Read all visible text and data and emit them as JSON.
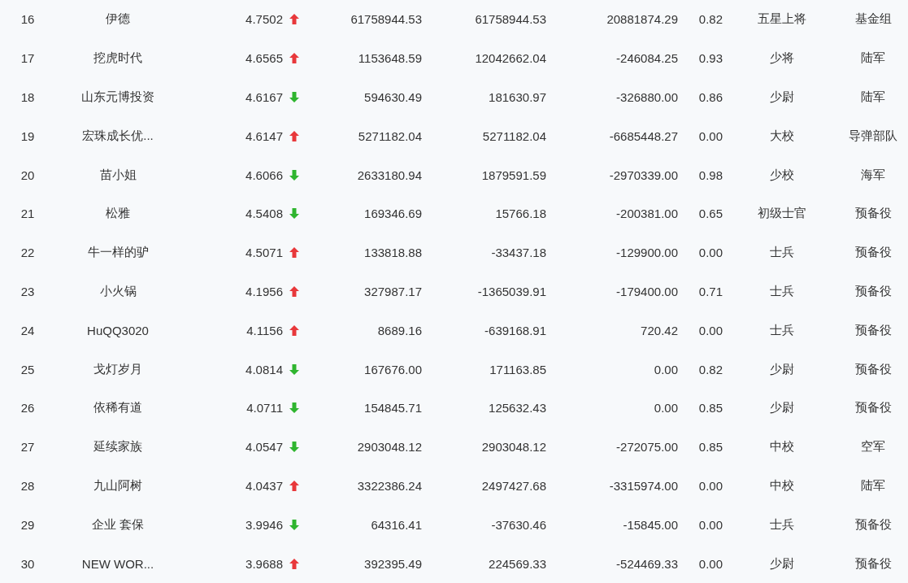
{
  "rows": [
    {
      "rank": "16",
      "name": "伊德",
      "score": "4.7502",
      "rising": true,
      "col_4": "61758944.53",
      "col_5": "61758944.53",
      "col_6": "20881874.29",
      "col_7": "0.82",
      "rank_title": "五星上将",
      "group": "基金组"
    },
    {
      "rank": "17",
      "name": "挖虎时代",
      "score": "4.6565",
      "rising": true,
      "col_4": "1153648.59",
      "col_5": "12042662.04",
      "col_6": "-246084.25",
      "col_7": "0.93",
      "rank_title": "少将",
      "group": "陆军"
    },
    {
      "rank": "18",
      "name": "山东元博投资",
      "score": "4.6167",
      "rising": false,
      "col_4": "594630.49",
      "col_5": "181630.97",
      "col_6": "-326880.00",
      "col_7": "0.86",
      "rank_title": "少尉",
      "group": "陆军"
    },
    {
      "rank": "19",
      "name": "宏珠成长优...",
      "score": "4.6147",
      "rising": true,
      "col_4": "5271182.04",
      "col_5": "5271182.04",
      "col_6": "-6685448.27",
      "col_7": "0.00",
      "rank_title": "大校",
      "group": "导弹部队"
    },
    {
      "rank": "20",
      "name": "苗小姐",
      "score": "4.6066",
      "rising": false,
      "col_4": "2633180.94",
      "col_5": "1879591.59",
      "col_6": "-2970339.00",
      "col_7": "0.98",
      "rank_title": "少校",
      "group": "海军"
    },
    {
      "rank": "21",
      "name": "松雅",
      "score": "4.5408",
      "rising": false,
      "col_4": "169346.69",
      "col_5": "15766.18",
      "col_6": "-200381.00",
      "col_7": "0.65",
      "rank_title": "初级士官",
      "group": "预备役"
    },
    {
      "rank": "22",
      "name": "牛一样的驴",
      "score": "4.5071",
      "rising": true,
      "col_4": "133818.88",
      "col_5": "-33437.18",
      "col_6": "-129900.00",
      "col_7": "0.00",
      "rank_title": "士兵",
      "group": "预备役"
    },
    {
      "rank": "23",
      "name": "小火锅",
      "score": "4.1956",
      "rising": true,
      "col_4": "327987.17",
      "col_5": "-1365039.91",
      "col_6": "-179400.00",
      "col_7": "0.71",
      "rank_title": "士兵",
      "group": "预备役"
    },
    {
      "rank": "24",
      "name": "HuQQ3020",
      "score": "4.1156",
      "rising": true,
      "col_4": "8689.16",
      "col_5": "-639168.91",
      "col_6": "720.42",
      "col_7": "0.00",
      "rank_title": "士兵",
      "group": "预备役"
    },
    {
      "rank": "25",
      "name": "戈灯岁月",
      "score": "4.0814",
      "rising": false,
      "col_4": "167676.00",
      "col_5": "171163.85",
      "col_6": "0.00",
      "col_7": "0.82",
      "rank_title": "少尉",
      "group": "预备役"
    },
    {
      "rank": "26",
      "name": "依稀有道",
      "score": "4.0711",
      "rising": false,
      "col_4": "154845.71",
      "col_5": "125632.43",
      "col_6": "0.00",
      "col_7": "0.85",
      "rank_title": "少尉",
      "group": "预备役"
    },
    {
      "rank": "27",
      "name": "延续家族",
      "score": "4.0547",
      "rising": false,
      "col_4": "2903048.12",
      "col_5": "2903048.12",
      "col_6": "-272075.00",
      "col_7": "0.85",
      "rank_title": "中校",
      "group": "空军"
    },
    {
      "rank": "28",
      "name": "九山阿树",
      "score": "4.0437",
      "rising": true,
      "col_4": "3322386.24",
      "col_5": "2497427.68",
      "col_6": "-3315974.00",
      "col_7": "0.00",
      "rank_title": "中校",
      "group": "陆军"
    },
    {
      "rank": "29",
      "name": "企业 套保",
      "score": "3.9946",
      "rising": false,
      "col_4": "64316.41",
      "col_5": "-37630.46",
      "col_6": "-15845.00",
      "col_7": "0.00",
      "rank_title": "士兵",
      "group": "预备役"
    },
    {
      "rank": "30",
      "name": "NEW WOR...",
      "score": "3.9688",
      "rising": true,
      "col_4": "392395.49",
      "col_5": "224569.33",
      "col_6": "-524469.33",
      "col_7": "0.00",
      "rank_title": "少尉",
      "group": "预备役"
    }
  ]
}
